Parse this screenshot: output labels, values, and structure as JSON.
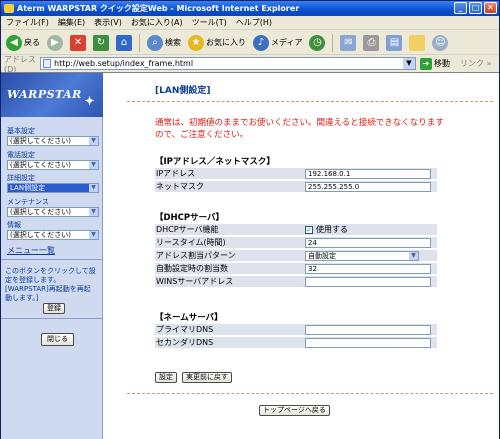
{
  "window": {
    "title": "Aterm WARPSTAR クイック設定Web - Microsoft Internet Explorer",
    "controls": {
      "minimize": "_",
      "maximize": "□",
      "close": "✕"
    }
  },
  "menubar": [
    "ファイル(F)",
    "編集(E)",
    "表示(V)",
    "お気に入り(A)",
    "ツール(T)",
    "ヘルプ(H)"
  ],
  "toolbar": {
    "back": "戻る",
    "search": "検索",
    "favorites": "お気に入り",
    "media": "メディア",
    "colors": {
      "back": "#2fa236",
      "stop": "#d8412f",
      "refresh": "#3b8e3b",
      "home": "#2f68c8"
    }
  },
  "address": {
    "label": "アドレス(D)",
    "url": "http://web.setup/index_frame.html",
    "go": "移動",
    "links": "リンク »"
  },
  "sidebar": {
    "logo": "WARPSTAR",
    "nav": [
      {
        "label": "基本設定",
        "value": "(選択してください)",
        "selected": false
      },
      {
        "label": "電話設定",
        "value": "(選択してください)",
        "selected": false
      },
      {
        "label": "詳細設定",
        "value": "LAN側設定",
        "selected": true
      },
      {
        "label": "メンテナンス",
        "value": "(選択してください)",
        "selected": false
      },
      {
        "label": "情報",
        "value": "(選択してください)",
        "selected": false
      }
    ],
    "menu_list": "メニュー一覧",
    "note": "このボタンをクリックして設定を登録します。[WARPSTAR]再起動を再起動します。]",
    "register": "登録",
    "close": "閉じる"
  },
  "main": {
    "title": "[LAN側設定]",
    "warning": "通常は、初期値のままでお使いください。間違えると接続できなくなりますので、ご注意ください。",
    "ip_section": {
      "heading": "【IPアドレス／ネットマスク】",
      "rows": [
        {
          "label": "IPアドレス",
          "value": "192.168.0.1"
        },
        {
          "label": "ネットマスク",
          "value": "255.255.255.0"
        }
      ]
    },
    "dhcp_section": {
      "heading": "【DHCPサーバ】",
      "function_label": "DHCPサーバ機能",
      "function_value": "使用する",
      "function_checked": true,
      "lease_label": "リースタイム(時間)",
      "lease_value": "24",
      "pattern_label": "アドレス割当パターン",
      "pattern_value": "自動設定",
      "count_label": "自動設定時の割当数",
      "count_value": "32",
      "wins_label": "WINSサーバアドレス",
      "wins_value": ""
    },
    "name_section": {
      "heading": "【ネームサーバ】",
      "primary_label": "プライマリDNS",
      "primary_value": "",
      "secondary_label": "セカンダリDNS",
      "secondary_value": ""
    },
    "set_button": "設定",
    "revert_button": "実更前に戻す",
    "top_button": "トップページへ戻る"
  }
}
